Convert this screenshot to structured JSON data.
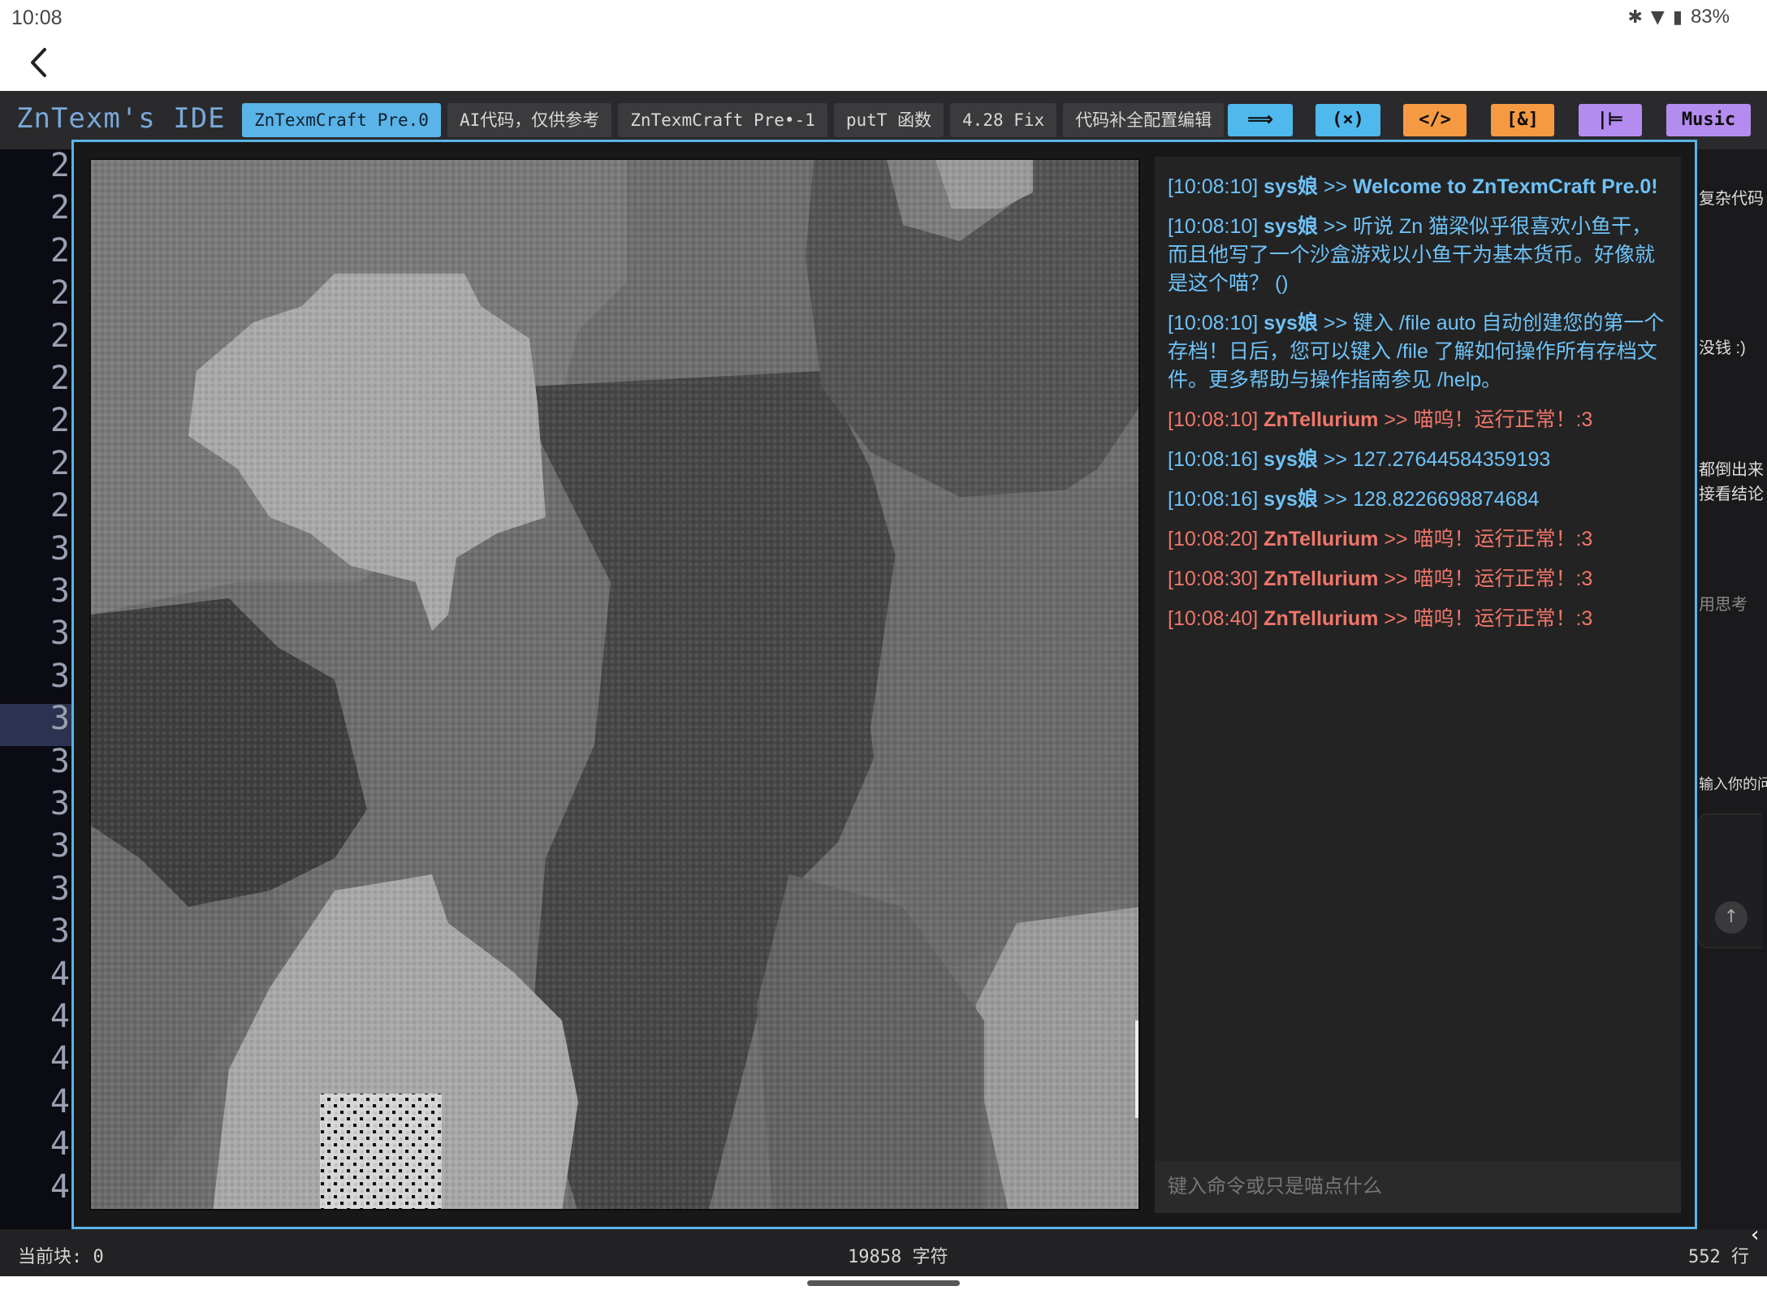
{
  "status_bar": {
    "time": "10:08",
    "icons": [
      "bluetooth-icon",
      "vibrate-icon",
      "wifi-icon",
      "battery-icon"
    ],
    "battery": "83%"
  },
  "ide": {
    "title": "ZnTexm's IDE",
    "tabs": [
      {
        "label": "ZnTexmCraft Pre.0",
        "active": true
      },
      {
        "label": "AI代码，仅供参考",
        "active": false
      },
      {
        "label": "ZnTexmCraft Pre•-1",
        "active": false
      },
      {
        "label": "putT 函数",
        "active": false
      },
      {
        "label": "4.28 Fix",
        "active": false
      },
      {
        "label": "代码补全配置编辑",
        "active": false
      }
    ],
    "tool_buttons": [
      {
        "label": "⟹",
        "color": "#4fb8ec"
      },
      {
        "label": "(×)",
        "color": "#4fb8ec"
      },
      {
        "label": "</>",
        "color": "#f59a42"
      },
      {
        "label": "[&]",
        "color": "#f59a42"
      },
      {
        "label": "|⊨",
        "color": "#b48cf0"
      },
      {
        "label": "Music",
        "color": "#b48cf0"
      }
    ],
    "line_numbers": [
      "2",
      "2",
      "2",
      "2",
      "2",
      "2",
      "2",
      "2",
      "2",
      "3",
      "3",
      "3",
      "3",
      "3",
      "3",
      "3",
      "3",
      "3",
      "3",
      "4",
      "4",
      "4",
      "4",
      "4",
      "4"
    ],
    "ai_side_texts": [
      "复杂代码",
      "没钱 :)",
      "都倒出来",
      "接看结论",
      "用思考",
      "输入你的问"
    ],
    "status": {
      "current_block": "当前块: 0",
      "chars": "19858 字符",
      "lines": "552 行"
    }
  },
  "game": {
    "chat_messages": [
      {
        "time": "[10:08:10]",
        "who": "sys娘",
        "sep": ">>",
        "text": "Welcome to ZnTexmCraft Pre.0!",
        "color": "blue",
        "bold": true
      },
      {
        "time": "[10:08:10]",
        "who": "sys娘",
        "sep": ">>",
        "text": "听说 Zn 猫梁似乎很喜欢小鱼干，而且他写了一个沙盒游戏以小鱼干为基本货币。好像就是这个喵？ ()",
        "color": "blue",
        "bold": false
      },
      {
        "time": "[10:08:10]",
        "who": "sys娘",
        "sep": ">>",
        "text": "键入 /file auto 自动创建您的第一个存档！日后，您可以键入 /file 了解如何操作所有存档文件。更多帮助与操作指南参见 /help。",
        "color": "blue",
        "bold": false
      },
      {
        "time": "[10:08:10]",
        "who": "ZnTellurium",
        "sep": ">>",
        "text": "喵呜！运行正常！:3",
        "color": "red",
        "bold": false
      },
      {
        "time": "[10:08:16]",
        "who": "sys娘",
        "sep": ">>",
        "text": "127.27644584359193",
        "color": "blue",
        "bold": false
      },
      {
        "time": "[10:08:16]",
        "who": "sys娘",
        "sep": ">>",
        "text": "128.8226698874684",
        "color": "blue",
        "bold": false
      },
      {
        "time": "[10:08:20]",
        "who": "ZnTellurium",
        "sep": ">>",
        "text": "喵呜！运行正常！:3",
        "color": "red",
        "bold": false
      },
      {
        "time": "[10:08:30]",
        "who": "ZnTellurium",
        "sep": ">>",
        "text": "喵呜！运行正常！:3",
        "color": "red",
        "bold": false
      },
      {
        "time": "[10:08:40]",
        "who": "ZnTellurium",
        "sep": ">>",
        "text": "喵呜！运行正常！:3",
        "color": "red",
        "bold": false
      }
    ],
    "chat_placeholder": "键入命令或只是喵点什么"
  }
}
